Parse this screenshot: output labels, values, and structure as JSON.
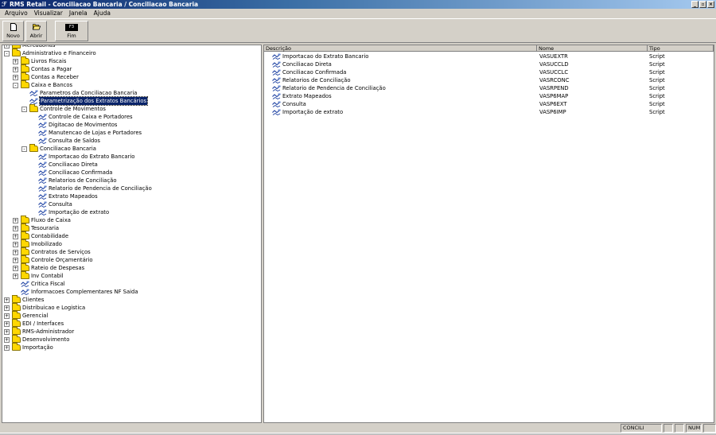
{
  "window": {
    "title": "RMS Retail - Conciliacao Bancaria / Conciliacao Bancaria",
    "buttons": [
      "_",
      "▫",
      "×"
    ]
  },
  "menu": [
    {
      "label": "Arquivo"
    },
    {
      "label": "Visualizar"
    },
    {
      "label": "Janela"
    },
    {
      "label": "Ajuda"
    }
  ],
  "toolbar": {
    "novo": "Novo",
    "abrir": "Abrir",
    "fim": "Fim",
    "fim_key": "F3"
  },
  "tree": [
    {
      "label": "Mercadorias",
      "type": "folder",
      "level": 0,
      "exp": "+"
    },
    {
      "label": "Administrativo e Financeiro",
      "type": "folder",
      "level": 0,
      "exp": "-"
    },
    {
      "label": "Livros Fiscais",
      "type": "folder",
      "level": 1,
      "exp": "+"
    },
    {
      "label": "Contas a Pagar",
      "type": "folder",
      "level": 1,
      "exp": "+"
    },
    {
      "label": "Contas a Receber",
      "type": "folder",
      "level": 1,
      "exp": "+"
    },
    {
      "label": "Caixa e Bancos",
      "type": "folder",
      "level": 1,
      "exp": "-"
    },
    {
      "label": "Parametros da Conciliacao Bancaria",
      "type": "script",
      "level": 2
    },
    {
      "label": "Parametrização dos Extratos Bancários",
      "type": "script",
      "level": 2,
      "selected": true
    },
    {
      "label": "Controle de Movimentos",
      "type": "folder",
      "level": 2,
      "exp": "-"
    },
    {
      "label": "Controle de Caixa e Portadores",
      "type": "script",
      "level": 3
    },
    {
      "label": "Digitacao de Movimentos",
      "type": "script",
      "level": 3
    },
    {
      "label": "Manutencao de Lojas e Portadores",
      "type": "script",
      "level": 3
    },
    {
      "label": "Consulta de Saldos",
      "type": "script",
      "level": 3
    },
    {
      "label": "Conciliacao Bancaria",
      "type": "folder",
      "level": 2,
      "exp": "-"
    },
    {
      "label": "Importacao do Extrato Bancario",
      "type": "script",
      "level": 3
    },
    {
      "label": "Conciliacao Direta",
      "type": "script",
      "level": 3
    },
    {
      "label": "Conciliacao Confirmada",
      "type": "script",
      "level": 3
    },
    {
      "label": "Relatorios de Conciliação",
      "type": "script",
      "level": 3
    },
    {
      "label": "Relatorio de Pendencia de Conciliação",
      "type": "script",
      "level": 3
    },
    {
      "label": "Extrato Mapeados",
      "type": "script",
      "level": 3
    },
    {
      "label": "Consulta",
      "type": "script",
      "level": 3
    },
    {
      "label": "Importação de extrato",
      "type": "script",
      "level": 3
    },
    {
      "label": "Fluxo de Caixa",
      "type": "folder",
      "level": 1,
      "exp": "+"
    },
    {
      "label": "Tesouraria",
      "type": "folder",
      "level": 1,
      "exp": "+"
    },
    {
      "label": "Contabilidade",
      "type": "folder",
      "level": 1,
      "exp": "+"
    },
    {
      "label": "Imobilizado",
      "type": "folder",
      "level": 1,
      "exp": "+"
    },
    {
      "label": "Contratos de Serviços",
      "type": "folder",
      "level": 1,
      "exp": "+"
    },
    {
      "label": "Controle Orçamentário",
      "type": "folder",
      "level": 1,
      "exp": "+"
    },
    {
      "label": "Rateio de Despesas",
      "type": "folder",
      "level": 1,
      "exp": "+"
    },
    {
      "label": "Inv Contabil",
      "type": "folder",
      "level": 1,
      "exp": "+"
    },
    {
      "label": "Critica Fiscal",
      "type": "script",
      "level": 1
    },
    {
      "label": "Informacoes Complementares NF Saida",
      "type": "script",
      "level": 1
    },
    {
      "label": "Clientes",
      "type": "folder",
      "level": 0,
      "exp": "+"
    },
    {
      "label": "Distribuicao e Logistica",
      "type": "folder",
      "level": 0,
      "exp": "+"
    },
    {
      "label": "Gerencial",
      "type": "folder",
      "level": 0,
      "exp": "+"
    },
    {
      "label": "EDI / Interfaces",
      "type": "folder",
      "level": 0,
      "exp": "+"
    },
    {
      "label": "RMS-Administrador",
      "type": "folder",
      "level": 0,
      "exp": "+"
    },
    {
      "label": "Desenvolvimento",
      "type": "folder",
      "level": 0,
      "exp": "+"
    },
    {
      "label": "Importação",
      "type": "folder",
      "level": 0,
      "exp": "+"
    }
  ],
  "list": {
    "columns": [
      "Descrição",
      "Nome",
      "Tipo"
    ],
    "rows": [
      {
        "desc": "Importacao do Extrato Bancario",
        "nome": "VASUEXTR",
        "tipo": "Script"
      },
      {
        "desc": "Conciliacao Direta",
        "nome": "VASUCCLD",
        "tipo": "Script"
      },
      {
        "desc": "Conciliacao Confirmada",
        "nome": "VASUCCLC",
        "tipo": "Script"
      },
      {
        "desc": "Relatorios de Conciliação",
        "nome": "VASRCONC",
        "tipo": "Script"
      },
      {
        "desc": "Relatorio de Pendencia de Conciliação",
        "nome": "VASRPEND",
        "tipo": "Script"
      },
      {
        "desc": "Extrato Mapeados",
        "nome": "VASP6MAP",
        "tipo": "Script"
      },
      {
        "desc": "Consulta",
        "nome": "VASP6EXT",
        "tipo": "Script"
      },
      {
        "desc": "Importação de extrato",
        "nome": "VASP6IMP",
        "tipo": "Script"
      }
    ]
  },
  "status": {
    "module": "CONCILI",
    "num": "NUM"
  }
}
